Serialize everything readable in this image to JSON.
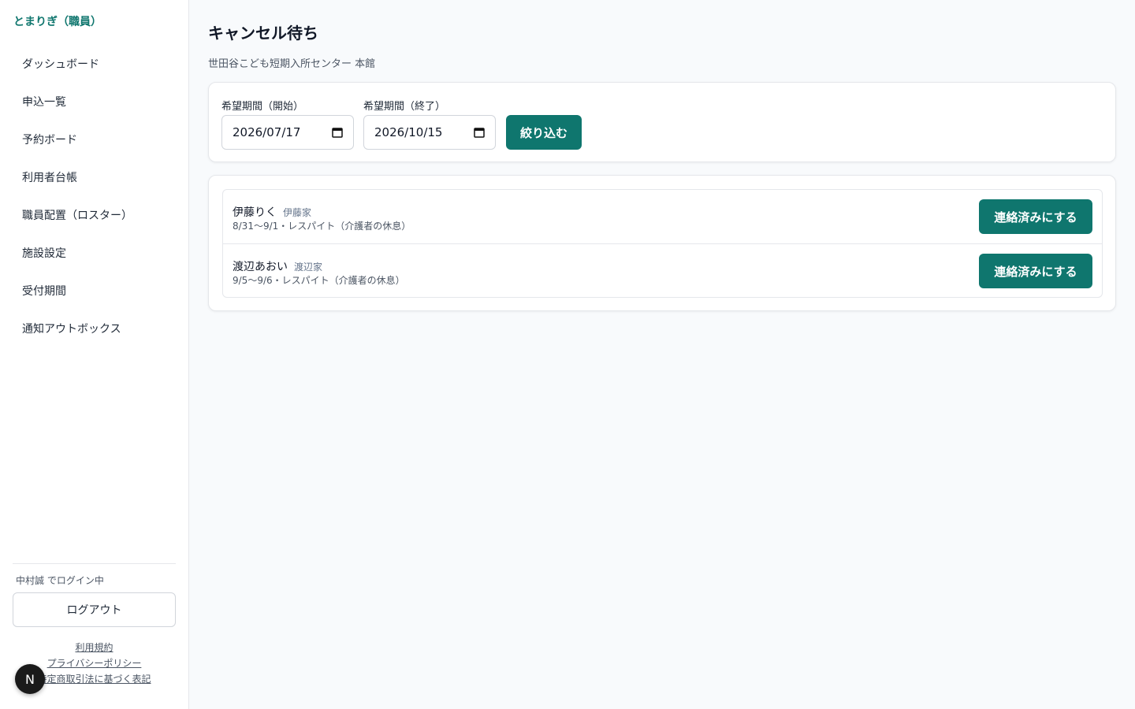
{
  "sidebar": {
    "brand": "とまりぎ（職員）",
    "nav": [
      {
        "label": "ダッシュボード"
      },
      {
        "label": "申込一覧"
      },
      {
        "label": "予約ボード"
      },
      {
        "label": "利用者台帳"
      },
      {
        "label": "職員配置（ロスター）"
      },
      {
        "label": "施設設定"
      },
      {
        "label": "受付期間"
      },
      {
        "label": "通知アウトボックス"
      }
    ],
    "login_status": "中村誠 でログイン中",
    "logout_label": "ログアウト",
    "footer_links": {
      "terms": "利用規約",
      "privacy": "プライバシーポリシー",
      "tokushoho": "特定商取引法に基づく表記"
    },
    "badge_letter": "N"
  },
  "main": {
    "title": "キャンセル待ち",
    "facility": "世田谷こども短期入所センター 本館",
    "filter": {
      "start_label": "希望期間（開始）",
      "start_value": "2026/07/17",
      "end_label": "希望期間（終了）",
      "end_value": "2026/10/15",
      "submit_label": "絞り込む"
    },
    "waitlist": [
      {
        "name": "伊藤りく",
        "family": "伊藤家",
        "detail": "8/31〜9/1・レスパイト（介護者の休息）",
        "action": "連絡済みにする"
      },
      {
        "name": "渡辺あおい",
        "family": "渡辺家",
        "detail": "9/5〜9/6・レスパイト（介護者の休息）",
        "action": "連絡済みにする"
      }
    ]
  },
  "colors": {
    "accent": "#0f766e",
    "background": "#f8fafc"
  }
}
